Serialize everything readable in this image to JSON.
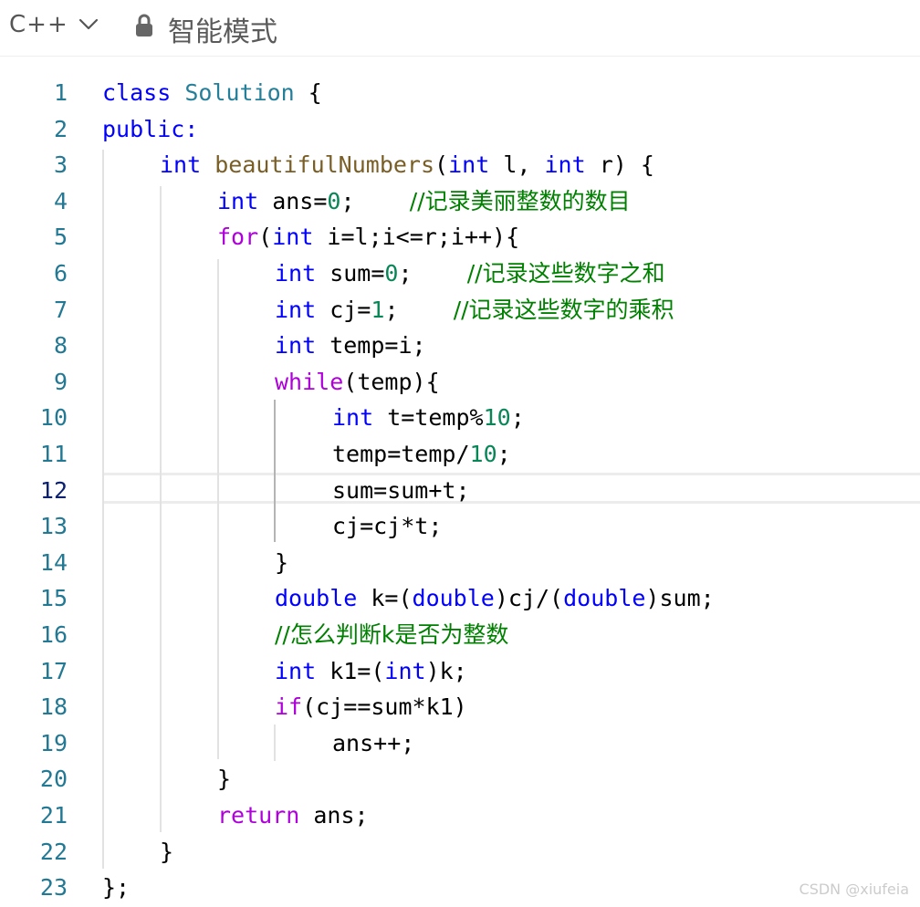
{
  "toolbar": {
    "language": "C++",
    "mode_label": "智能模式"
  },
  "editor": {
    "current_line": 12,
    "line_numbers": [
      "1",
      "2",
      "3",
      "4",
      "5",
      "6",
      "7",
      "8",
      "9",
      "10",
      "11",
      "12",
      "13",
      "14",
      "15",
      "16",
      "17",
      "18",
      "19",
      "20",
      "21",
      "22",
      "23"
    ],
    "lines": [
      {
        "indent": 0,
        "tokens": [
          {
            "t": "class",
            "c": "kw"
          },
          {
            "t": " "
          },
          {
            "t": "Solution",
            "c": "typ"
          },
          {
            "t": " {"
          }
        ]
      },
      {
        "indent": 0,
        "tokens": [
          {
            "t": "public:",
            "c": "kw"
          }
        ]
      },
      {
        "indent": 1,
        "tokens": [
          {
            "t": "int",
            "c": "kw"
          },
          {
            "t": " "
          },
          {
            "t": "beautifulNumbers",
            "c": "fn"
          },
          {
            "t": "("
          },
          {
            "t": "int",
            "c": "kw"
          },
          {
            "t": " l, "
          },
          {
            "t": "int",
            "c": "kw"
          },
          {
            "t": " r) {"
          }
        ]
      },
      {
        "indent": 2,
        "tokens": [
          {
            "t": "int",
            "c": "kw"
          },
          {
            "t": " ans="
          },
          {
            "t": "0",
            "c": "num"
          },
          {
            "t": ";    "
          },
          {
            "t": "//记录美丽整数的数目",
            "c": "cm"
          }
        ]
      },
      {
        "indent": 2,
        "tokens": [
          {
            "t": "for",
            "c": "ctl"
          },
          {
            "t": "("
          },
          {
            "t": "int",
            "c": "kw"
          },
          {
            "t": " i=l;i<=r;i++){"
          }
        ]
      },
      {
        "indent": 3,
        "tokens": [
          {
            "t": "int",
            "c": "kw"
          },
          {
            "t": " sum="
          },
          {
            "t": "0",
            "c": "num"
          },
          {
            "t": ";    "
          },
          {
            "t": "//记录这些数字之和",
            "c": "cm"
          }
        ]
      },
      {
        "indent": 3,
        "tokens": [
          {
            "t": "int",
            "c": "kw"
          },
          {
            "t": " cj="
          },
          {
            "t": "1",
            "c": "num"
          },
          {
            "t": ";    "
          },
          {
            "t": "//记录这些数字的乘积",
            "c": "cm"
          }
        ]
      },
      {
        "indent": 3,
        "tokens": [
          {
            "t": "int",
            "c": "kw"
          },
          {
            "t": " temp=i;"
          }
        ]
      },
      {
        "indent": 3,
        "tokens": [
          {
            "t": "while",
            "c": "ctl"
          },
          {
            "t": "(temp){"
          }
        ]
      },
      {
        "indent": 4,
        "tokens": [
          {
            "t": "int",
            "c": "kw"
          },
          {
            "t": " t=temp%"
          },
          {
            "t": "10",
            "c": "num"
          },
          {
            "t": ";"
          }
        ]
      },
      {
        "indent": 4,
        "tokens": [
          {
            "t": "temp=temp/"
          },
          {
            "t": "10",
            "c": "num"
          },
          {
            "t": ";"
          }
        ]
      },
      {
        "indent": 4,
        "tokens": [
          {
            "t": "sum=sum+t;"
          }
        ]
      },
      {
        "indent": 4,
        "tokens": [
          {
            "t": "cj=cj*t;"
          }
        ]
      },
      {
        "indent": 3,
        "tokens": [
          {
            "t": "}"
          }
        ]
      },
      {
        "indent": 3,
        "tokens": [
          {
            "t": "double",
            "c": "kw"
          },
          {
            "t": " k=("
          },
          {
            "t": "double",
            "c": "kw"
          },
          {
            "t": ")cj/("
          },
          {
            "t": "double",
            "c": "kw"
          },
          {
            "t": ")sum;"
          }
        ]
      },
      {
        "indent": 3,
        "tokens": [
          {
            "t": "//怎么判断k是否为整数",
            "c": "cm"
          }
        ]
      },
      {
        "indent": 3,
        "tokens": [
          {
            "t": "int",
            "c": "kw"
          },
          {
            "t": " k1=("
          },
          {
            "t": "int",
            "c": "kw"
          },
          {
            "t": ")k;"
          }
        ]
      },
      {
        "indent": 3,
        "tokens": [
          {
            "t": "if",
            "c": "ctl"
          },
          {
            "t": "(cj==sum*k1)"
          }
        ]
      },
      {
        "indent": 4,
        "tokens": [
          {
            "t": "ans++;"
          }
        ]
      },
      {
        "indent": 2,
        "tokens": [
          {
            "t": "}"
          }
        ]
      },
      {
        "indent": 2,
        "tokens": [
          {
            "t": "return",
            "c": "ctl"
          },
          {
            "t": " ans;"
          }
        ]
      },
      {
        "indent": 1,
        "tokens": [
          {
            "t": "}"
          }
        ]
      },
      {
        "indent": 0,
        "tokens": [
          {
            "t": "};"
          }
        ]
      }
    ]
  },
  "watermark": "CSDN @xiufeia",
  "icons": {
    "language_dropdown": "chevron-down-icon",
    "mode": "lock-icon"
  }
}
